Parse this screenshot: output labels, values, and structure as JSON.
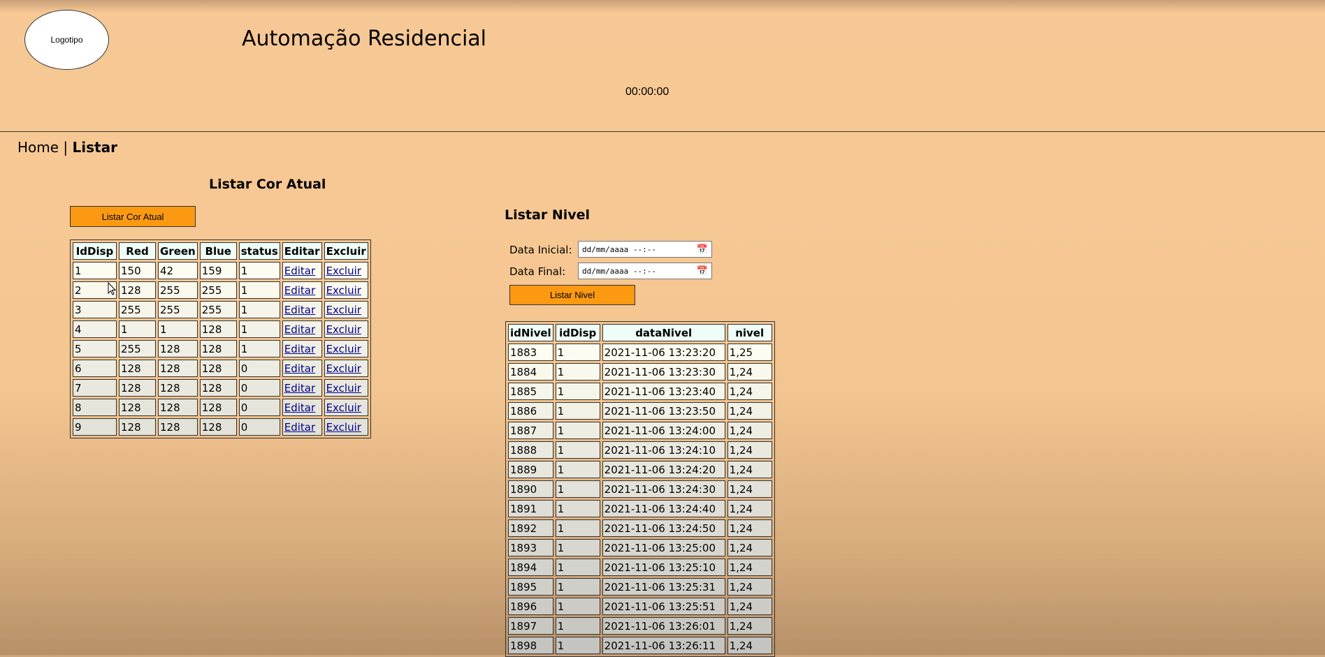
{
  "header": {
    "logo_text": "Logotipo",
    "title": "Automação Residencial",
    "clock": "00:00:00"
  },
  "breadcrumb": {
    "home": "Home",
    "separator": "|",
    "current": "Listar"
  },
  "cor": {
    "title": "Listar Cor Atual",
    "button": "Listar Cor Atual",
    "columns": [
      "IdDisp",
      "Red",
      "Green",
      "Blue",
      "status",
      "Editar",
      "Excluir"
    ],
    "rows": [
      {
        "id": "1",
        "red": "150",
        "green": "42",
        "blue": "159",
        "status": "1",
        "edit": "Editar",
        "del": "Excluir"
      },
      {
        "id": "2",
        "red": "128",
        "green": "255",
        "blue": "255",
        "status": "1",
        "edit": "Editar",
        "del": "Excluir"
      },
      {
        "id": "3",
        "red": "255",
        "green": "255",
        "blue": "255",
        "status": "1",
        "edit": "Editar",
        "del": "Excluir"
      },
      {
        "id": "4",
        "red": "1",
        "green": "1",
        "blue": "128",
        "status": "1",
        "edit": "Editar",
        "del": "Excluir"
      },
      {
        "id": "5",
        "red": "255",
        "green": "128",
        "blue": "128",
        "status": "1",
        "edit": "Editar",
        "del": "Excluir"
      },
      {
        "id": "6",
        "red": "128",
        "green": "128",
        "blue": "128",
        "status": "0",
        "edit": "Editar",
        "del": "Excluir"
      },
      {
        "id": "7",
        "red": "128",
        "green": "128",
        "blue": "128",
        "status": "0",
        "edit": "Editar",
        "del": "Excluir"
      },
      {
        "id": "8",
        "red": "128",
        "green": "128",
        "blue": "128",
        "status": "0",
        "edit": "Editar",
        "del": "Excluir"
      },
      {
        "id": "9",
        "red": "128",
        "green": "128",
        "blue": "128",
        "status": "0",
        "edit": "Editar",
        "del": "Excluir"
      }
    ]
  },
  "nivel": {
    "title": "Listar Nivel",
    "label_inicial": "Data Inicial:",
    "label_final": "Data Final:",
    "date_placeholder": "dd/mm/aaaa --:--",
    "button": "Listar Nivel",
    "columns": [
      "idNivel",
      "idDisp",
      "dataNivel",
      "nivel"
    ],
    "rows": [
      {
        "id": "1883",
        "disp": "1",
        "data": "2021-11-06 13:23:20",
        "nivel": "1,25"
      },
      {
        "id": "1884",
        "disp": "1",
        "data": "2021-11-06 13:23:30",
        "nivel": "1,24"
      },
      {
        "id": "1885",
        "disp": "1",
        "data": "2021-11-06 13:23:40",
        "nivel": "1,24"
      },
      {
        "id": "1886",
        "disp": "1",
        "data": "2021-11-06 13:23:50",
        "nivel": "1,24"
      },
      {
        "id": "1887",
        "disp": "1",
        "data": "2021-11-06 13:24:00",
        "nivel": "1,24"
      },
      {
        "id": "1888",
        "disp": "1",
        "data": "2021-11-06 13:24:10",
        "nivel": "1,24"
      },
      {
        "id": "1889",
        "disp": "1",
        "data": "2021-11-06 13:24:20",
        "nivel": "1,24"
      },
      {
        "id": "1890",
        "disp": "1",
        "data": "2021-11-06 13:24:30",
        "nivel": "1,24"
      },
      {
        "id": "1891",
        "disp": "1",
        "data": "2021-11-06 13:24:40",
        "nivel": "1,24"
      },
      {
        "id": "1892",
        "disp": "1",
        "data": "2021-11-06 13:24:50",
        "nivel": "1,24"
      },
      {
        "id": "1893",
        "disp": "1",
        "data": "2021-11-06 13:25:00",
        "nivel": "1,24"
      },
      {
        "id": "1894",
        "disp": "1",
        "data": "2021-11-06 13:25:10",
        "nivel": "1,24"
      },
      {
        "id": "1895",
        "disp": "1",
        "data": "2021-11-06 13:25:31",
        "nivel": "1,24"
      },
      {
        "id": "1896",
        "disp": "1",
        "data": "2021-11-06 13:25:51",
        "nivel": "1,24"
      },
      {
        "id": "1897",
        "disp": "1",
        "data": "2021-11-06 13:26:01",
        "nivel": "1,24"
      },
      {
        "id": "1898",
        "disp": "1",
        "data": "2021-11-06 13:26:11",
        "nivel": "1,24"
      }
    ]
  },
  "colors": {
    "button_orange": "#fb9a12",
    "cell_top": "#fdfcf0",
    "cell_bottom": "#c4c4c0",
    "header_cell": "#eefdf8",
    "link": "#00008b"
  }
}
